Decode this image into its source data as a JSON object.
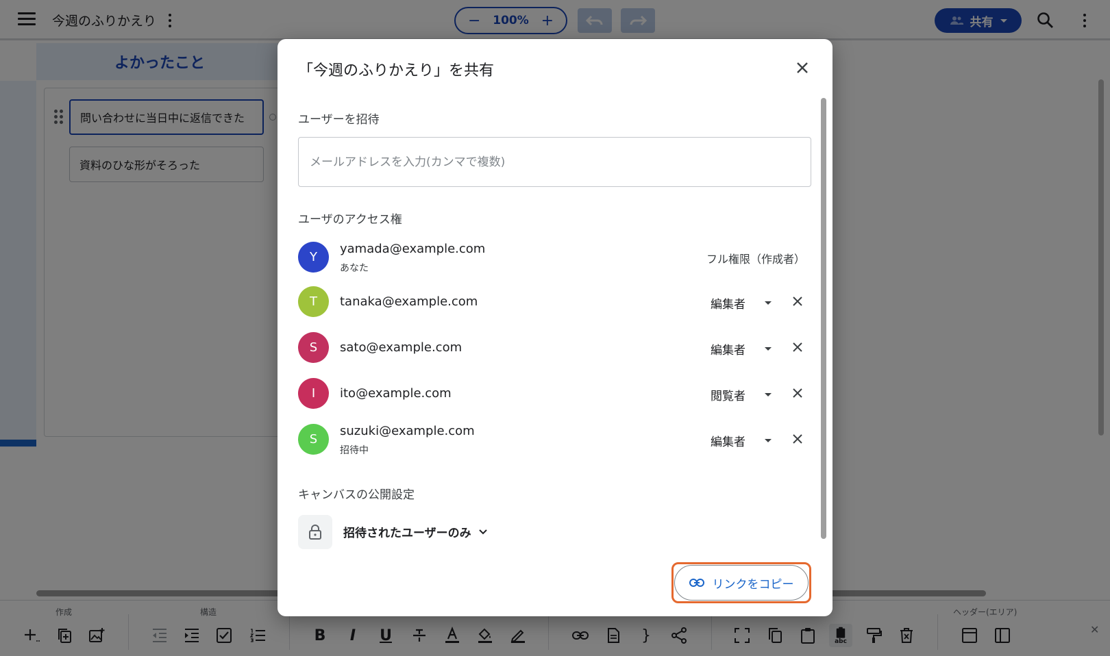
{
  "header": {
    "doc_title": "今週のふりかえり",
    "zoom": {
      "minus": "−",
      "level": "100%",
      "plus": "+"
    },
    "share_label": "共有"
  },
  "canvas": {
    "column_title": "よかったこと",
    "cards": [
      {
        "text": "問い合わせに当日中に返信できた"
      },
      {
        "text": "資料のひな形がそろった"
      }
    ]
  },
  "toolbar": {
    "groups": {
      "create": "作成",
      "structure": "構造",
      "header_area": "ヘッダー(エリア)"
    },
    "bold": "B",
    "italic": "I",
    "underline": "U",
    "brace": "}",
    "abc": "abc"
  },
  "dialog": {
    "title": "「今週のふりかえり」を共有",
    "invite_label": "ユーザーを招待",
    "invite_placeholder": "メールアドレスを入力(カンマで複数)",
    "access_label": "ユーザのアクセス権",
    "users": [
      {
        "initial": "Y",
        "email": "yamada@example.com",
        "sub": "あなた",
        "role": "フル権限（作成者）",
        "color": "#2c45c9"
      },
      {
        "initial": "T",
        "email": "tanaka@example.com",
        "sub": "",
        "role": "編集者",
        "color": "#9fc33b"
      },
      {
        "initial": "S",
        "email": "sato@example.com",
        "sub": "",
        "role": "編集者",
        "color": "#c2315f"
      },
      {
        "initial": "I",
        "email": "ito@example.com",
        "sub": "",
        "role": "閲覧者",
        "color": "#c72e5c"
      },
      {
        "initial": "S",
        "email": "suzuki@example.com",
        "sub": "招待中",
        "role": "編集者",
        "color": "#5acc4f"
      }
    ],
    "visibility_label": "キャンバスの公開設定",
    "visibility_value": "招待されたユーザーのみ",
    "copy_link_label": "リンクをコピー"
  }
}
